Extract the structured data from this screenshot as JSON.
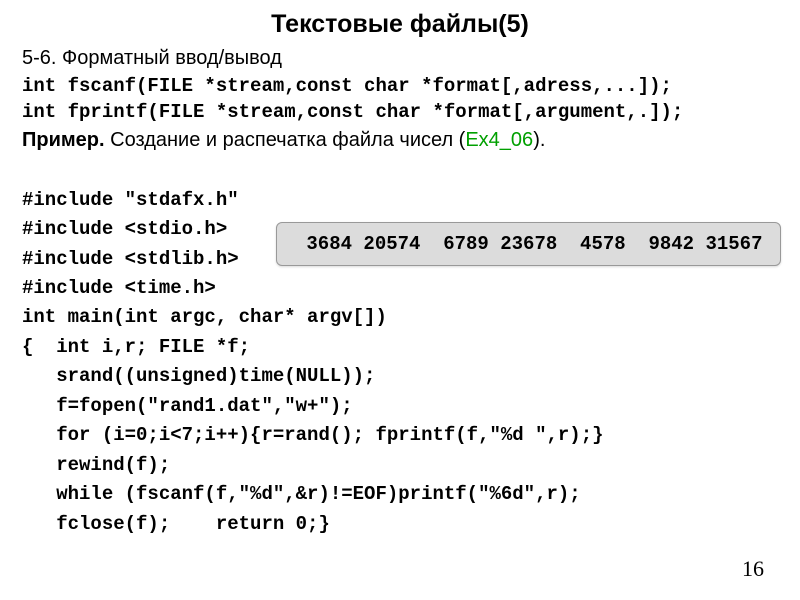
{
  "title": "Текстовые файлы(5)",
  "subheading": "5-6. Форматный ввод/вывод",
  "sigs": {
    "fscanf": "int fscanf(FILE *stream,const char *format[,adress,...]);",
    "fprintf": "int fprintf(FILE *stream,const char *format[,argument,.]);"
  },
  "example": {
    "label": "Пример.",
    "text": " Создание и распечатка  файла чисел (",
    "ref": "Ex4_06",
    "tail": ")."
  },
  "code": {
    "l1": "#include \"stdafx.h\"",
    "l2": "#include <stdio.h>",
    "l3": "#include <stdlib.h>",
    "l4": "#include <time.h>",
    "l5": "int main(int argc, char* argv[])",
    "l6": "{  int i,r; FILE *f;",
    "l7": "   srand((unsigned)time(NULL));",
    "l8": "   f=fopen(\"rand1.dat\",\"w+\");",
    "l9": "   for (i=0;i<7;i++){r=rand(); fprintf(f,\"%d \",r);}",
    "l10": "   rewind(f);",
    "l11": "   while (fscanf(f,\"%d\",&r)!=EOF)printf(\"%6d\",r);",
    "l12": "   fclose(f);    return 0;}"
  },
  "output": " 3684 20574  6789 23678  4578  9842 31567",
  "page_number": "16"
}
